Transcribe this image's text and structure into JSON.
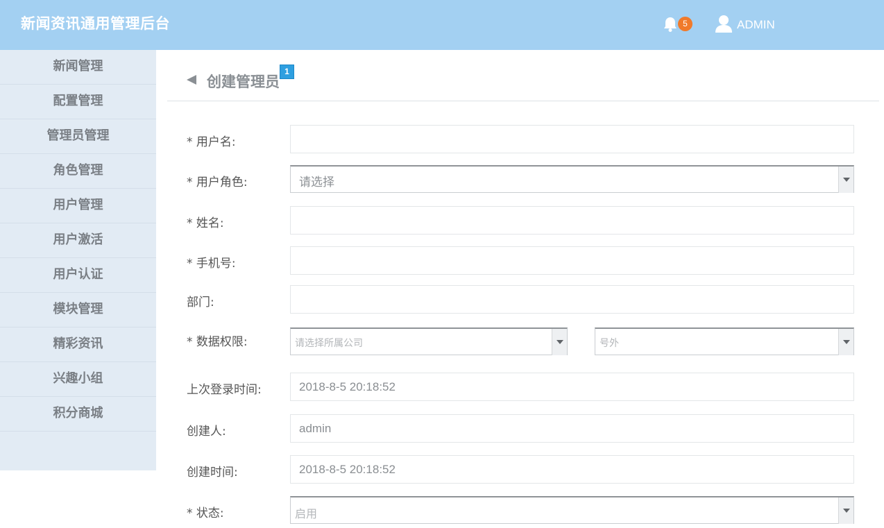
{
  "header": {
    "title": "新闻资讯通用管理后台",
    "notification_count": "5",
    "user_name": "ADMIN",
    "bell_icon": "bell-icon",
    "avatar_icon": "user-avatar-icon"
  },
  "sidebar": {
    "items": [
      {
        "label": "新闻管理"
      },
      {
        "label": "配置管理"
      },
      {
        "label": "管理员管理"
      },
      {
        "label": "角色管理"
      },
      {
        "label": "用户管理"
      },
      {
        "label": "用户激活"
      },
      {
        "label": "用户认证"
      },
      {
        "label": "模块管理"
      },
      {
        "label": "精彩资讯"
      },
      {
        "label": "兴趣小组"
      },
      {
        "label": "积分商城"
      }
    ]
  },
  "page": {
    "title": "创建管理员",
    "badge": "1"
  },
  "form": {
    "username_label": "* 用户名:",
    "username_value": "",
    "role_label": "* 用户角色:",
    "role_value": "请选择",
    "name_label": "* 姓名:",
    "name_value": "",
    "phone_label": "* 手机号:",
    "phone_value": "",
    "dept_label": "部门:",
    "dept_value": "",
    "data_perm_label": "* 数据权限:",
    "company_value": "请选择所属公司",
    "extra_value": "号外",
    "last_login_label": "上次登录时间:",
    "last_login_value": "2018-8-5 20:18:52",
    "creator_label": "创建人:",
    "creator_value": "admin",
    "created_time_label": "创建时间:",
    "created_time_value": "2018-8-5 20:18:52",
    "status_label": "* 状态:",
    "status_value": "启用"
  },
  "colors": {
    "header_bg": "#a3d0f2",
    "sidebar_bg": "#e2ebf4",
    "badge_orange": "#f07a2b",
    "badge_blue": "#2e9fe0"
  }
}
